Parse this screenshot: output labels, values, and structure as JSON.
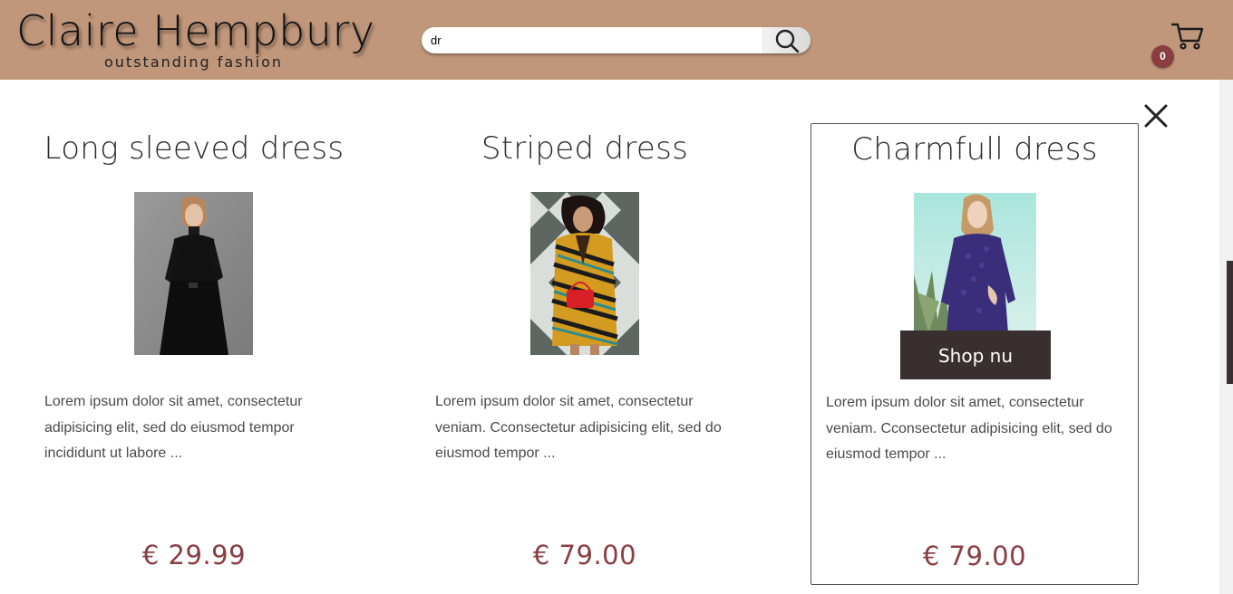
{
  "header": {
    "logo_title": "Claire Hempbury",
    "logo_subtitle": "outstanding fashion",
    "background_color": "#c0977b"
  },
  "search": {
    "value": "dr",
    "button_icon": "search-icon"
  },
  "cart": {
    "icon": "cart-icon",
    "count": "0",
    "badge_color": "#8a3e42"
  },
  "close_icon": "close-icon",
  "products": [
    {
      "title": "Long sleeved dress",
      "image": "woman in black long sleeved dress",
      "description": "Lorem ipsum dolor sit amet, consectetur adipisicing elit, sed do eiusmod tempor incididunt ut labore ...",
      "price": "€ 29.99"
    },
    {
      "title": "Striped dress",
      "image": "woman in striped coat with red bag",
      "description": "Lorem ipsum dolor sit amet, consectetur veniam. Cconsectetur adipisicing elit, sed do eiusmod tempor ...",
      "price": "€ 79.00"
    },
    {
      "title": "Charmfull dress",
      "image": "woman in purple lace dress",
      "description": "Lorem ipsum dolor sit amet, consectetur veniam. Cconsectetur adipisicing elit, sed do eiusmod tempor ...",
      "price": "€ 79.00",
      "button_label": "Shop nu"
    }
  ],
  "colors": {
    "price": "#8a3e42",
    "button": "#3a2f2f"
  }
}
